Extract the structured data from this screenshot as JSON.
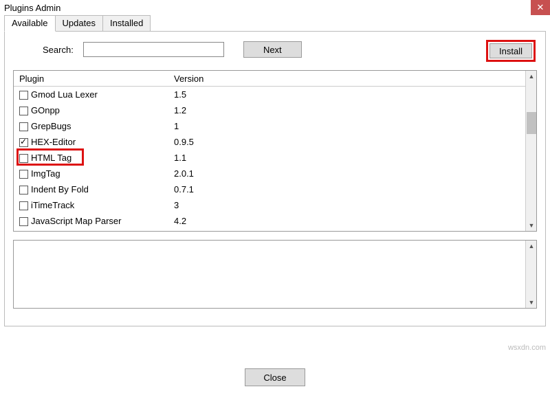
{
  "window": {
    "title": "Plugins Admin"
  },
  "tabs": [
    {
      "label": "Available",
      "active": true
    },
    {
      "label": "Updates",
      "active": false
    },
    {
      "label": "Installed",
      "active": false
    }
  ],
  "search": {
    "label": "Search:",
    "value": "",
    "placeholder": ""
  },
  "buttons": {
    "next": "Next",
    "install": "Install",
    "close": "Close"
  },
  "columns": {
    "plugin": "Plugin",
    "version": "Version"
  },
  "plugins": [
    {
      "name": "Gmod Lua Lexer",
      "version": "1.5",
      "checked": false
    },
    {
      "name": "GOnpp",
      "version": "1.2",
      "checked": false
    },
    {
      "name": "GrepBugs",
      "version": "1",
      "checked": false
    },
    {
      "name": "HEX-Editor",
      "version": "0.9.5",
      "checked": true
    },
    {
      "name": "HTML Tag",
      "version": "1.1",
      "checked": false
    },
    {
      "name": "ImgTag",
      "version": "2.0.1",
      "checked": false
    },
    {
      "name": "Indent By Fold",
      "version": "0.7.1",
      "checked": false
    },
    {
      "name": "iTimeTrack",
      "version": "3",
      "checked": false
    },
    {
      "name": "JavaScript Map Parser",
      "version": "4.2",
      "checked": false
    }
  ],
  "watermark": "wsxdn.com"
}
